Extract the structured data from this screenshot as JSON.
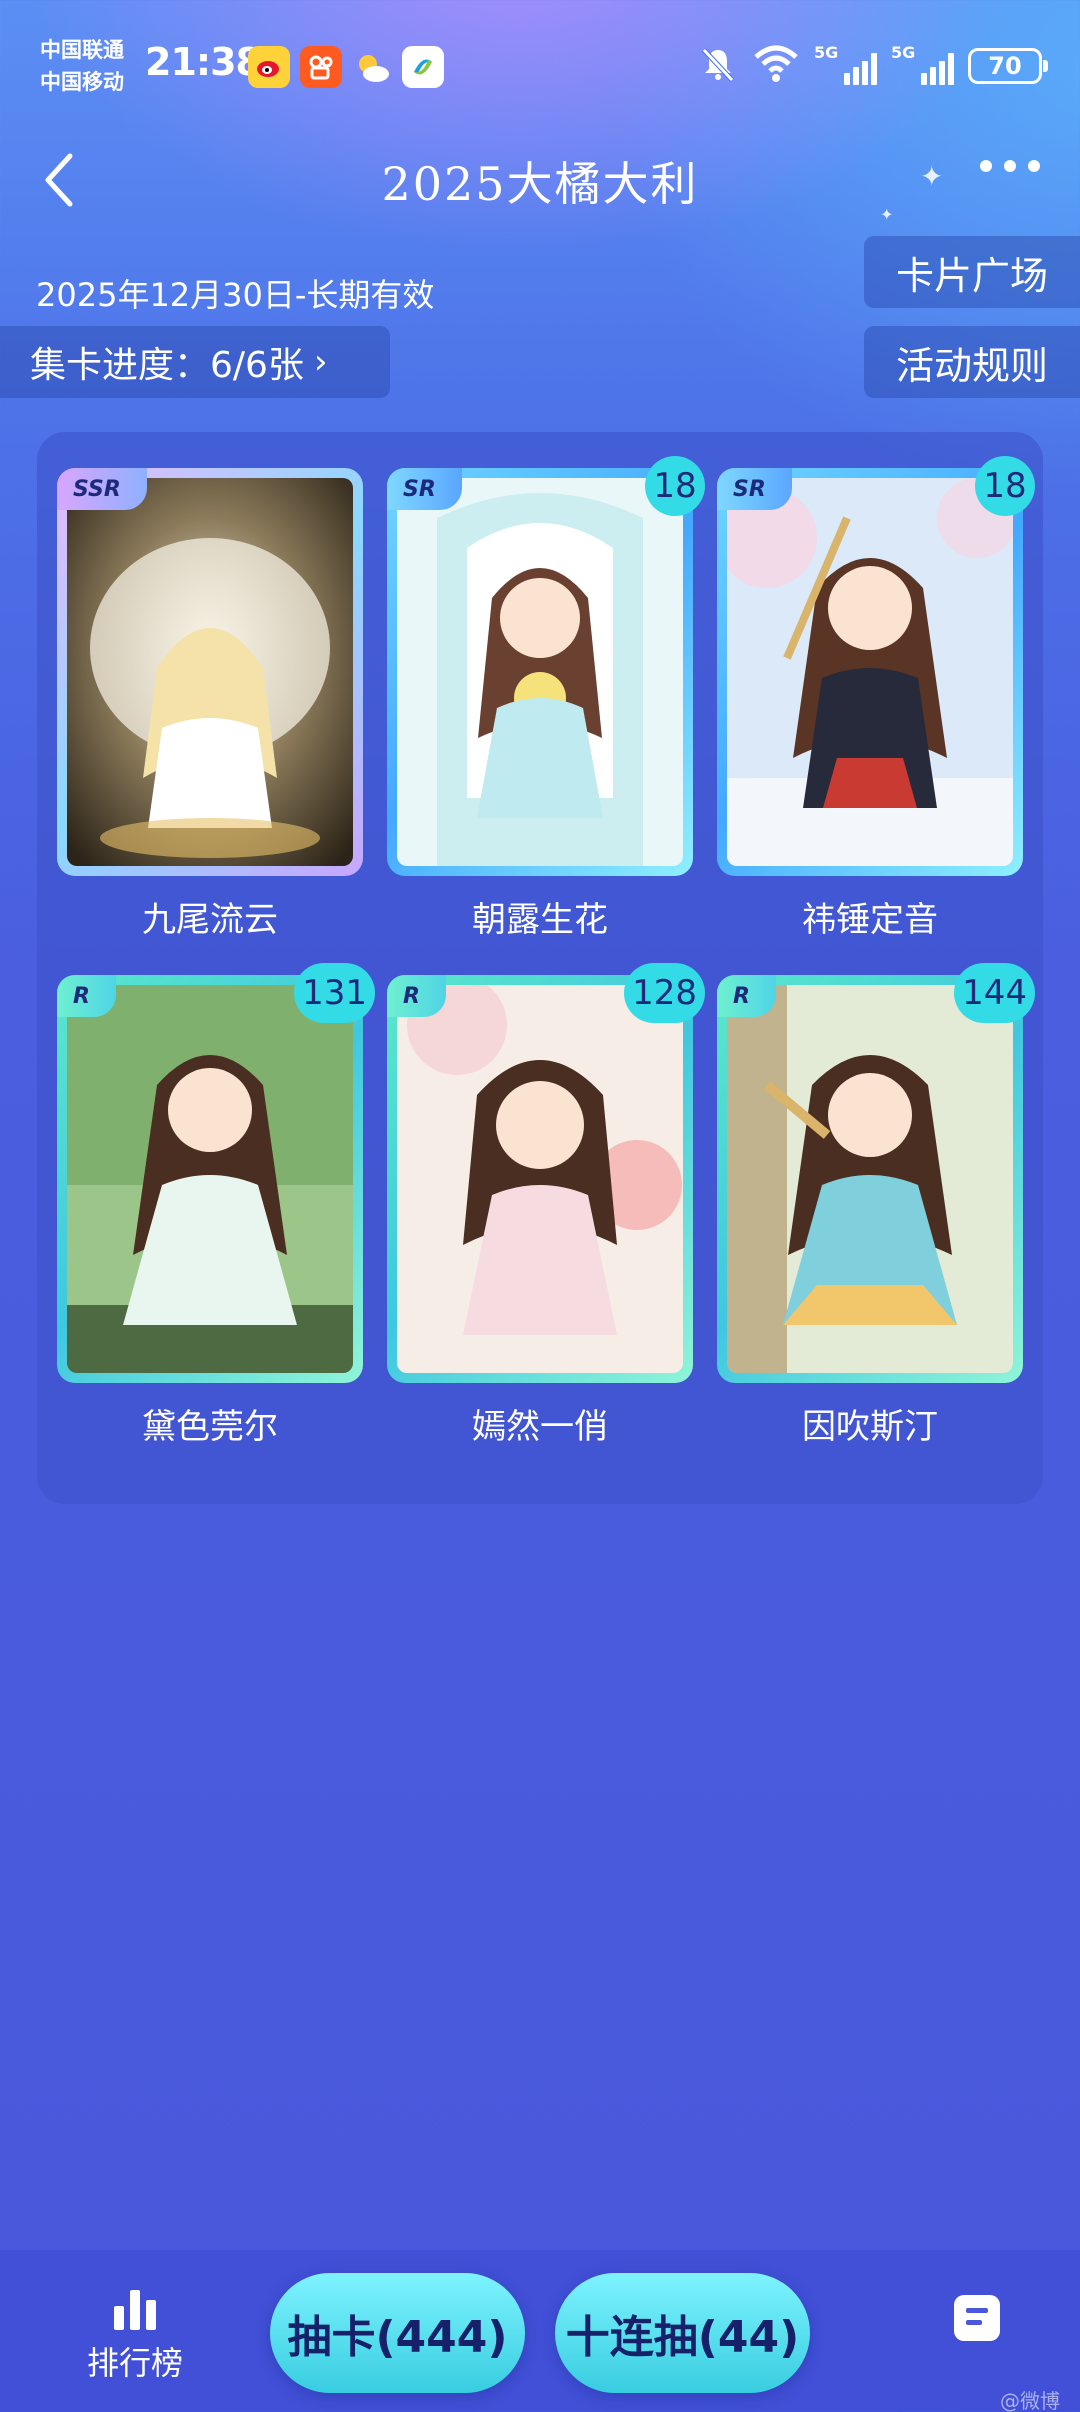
{
  "status_bar": {
    "carrier1": "中国联通",
    "carrier2": "中国移动",
    "time": "21:38",
    "network1": "5G",
    "network2": "5G",
    "battery": "70",
    "app_icons": [
      "weibo-icon",
      "kuaishou-icon",
      "weather-icon",
      "china-mobile-icon"
    ],
    "right_icons": [
      "mute-bell-icon",
      "wifi-icon",
      "signal-icon",
      "signal-icon",
      "battery-icon"
    ]
  },
  "header": {
    "title": "2025大橘大利",
    "back_icon": "chevron-left-icon",
    "more_icon": "more-dots-icon"
  },
  "info": {
    "date_range": "2025年12月30日-长期有效",
    "progress_label": "集卡进度：6/6张",
    "progress_chevron": "›",
    "plaza_button": "卡片广场",
    "rules_button": "活动规则"
  },
  "cards": [
    {
      "name": "九尾流云",
      "rarity": "SSR",
      "count": null
    },
    {
      "name": "朝露生花",
      "rarity": "SR",
      "count": "18"
    },
    {
      "name": "祎锤定音",
      "rarity": "SR",
      "count": "18"
    },
    {
      "name": "黛色莞尔",
      "rarity": "R",
      "count": "131"
    },
    {
      "name": "嫣然一俏",
      "rarity": "R",
      "count": "128"
    },
    {
      "name": "因吹斯汀",
      "rarity": "R",
      "count": "144"
    }
  ],
  "bottom": {
    "rank_label": "排行榜",
    "draw_one": "抽卡(444)",
    "draw_ten": "十连抽(44)",
    "notes_icon": "notes-icon",
    "watermark": "@微博"
  },
  "colors": {
    "accent": "#33dbe6",
    "background": "#4a58dc",
    "ssr_frame": "#c9a7ff",
    "sr_frame": "#52c7ff",
    "r_frame": "#3fe0c8"
  }
}
